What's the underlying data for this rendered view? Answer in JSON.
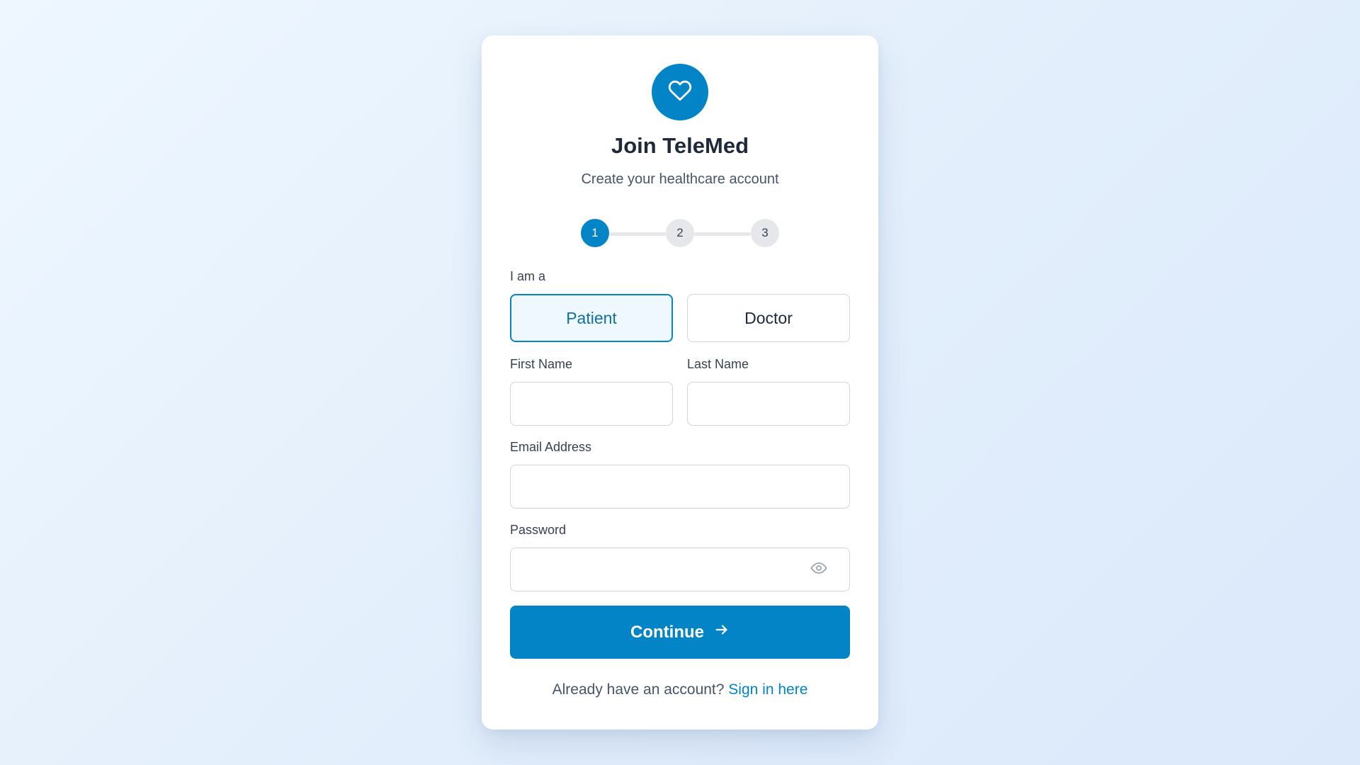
{
  "colors": {
    "brand": "#0284c7",
    "step_inactive": "#e5e7eb",
    "text_dark": "#1e293b",
    "text_muted": "#475569"
  },
  "header": {
    "logo_icon": "heart-icon",
    "title": "Join TeleMed",
    "subtitle": "Create your healthcare account"
  },
  "stepper": {
    "steps": [
      "1",
      "2",
      "3"
    ],
    "current_step": 1
  },
  "form": {
    "role_label": "I am a",
    "roles": [
      {
        "label": "Patient",
        "selected": true
      },
      {
        "label": "Doctor",
        "selected": false
      }
    ],
    "first_name_label": "First Name",
    "first_name_value": "",
    "last_name_label": "Last Name",
    "last_name_value": "",
    "email_label": "Email Address",
    "email_value": "",
    "password_label": "Password",
    "password_value": "",
    "password_toggle_icon": "eye-icon",
    "continue_label": "Continue",
    "continue_icon": "arrow-right-icon"
  },
  "footer": {
    "prompt": "Already have an account?",
    "link_text": "Sign in here"
  }
}
